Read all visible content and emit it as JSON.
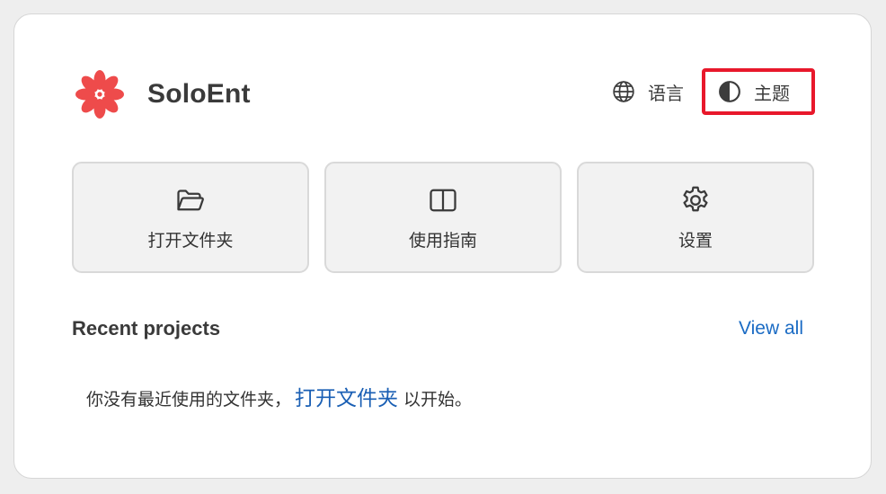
{
  "header": {
    "app_name": "SoloEnt",
    "logo_icon": "flower-logo",
    "logo_color": "#ee4b4b",
    "language_label": "语言",
    "language_icon": "globe-icon",
    "theme_label": "主题",
    "theme_icon": "contrast-icon",
    "highlight_color": "#e8182b"
  },
  "tiles": [
    {
      "label": "打开文件夹",
      "icon": "folder-open-icon"
    },
    {
      "label": "使用指南",
      "icon": "book-icon"
    },
    {
      "label": "设置",
      "icon": "gear-icon"
    }
  ],
  "recent": {
    "title": "Recent projects",
    "view_all": "View all",
    "empty_prefix": "你没有最近使用的文件夹，",
    "empty_link": "打开文件夹",
    "empty_suffix": "以开始。",
    "link_color": "#1a6bc4"
  }
}
